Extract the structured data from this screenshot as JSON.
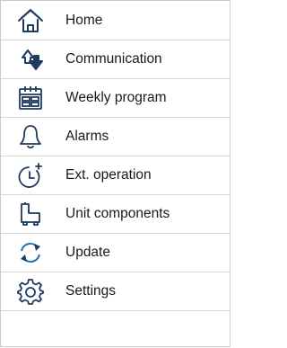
{
  "menu": {
    "items": [
      {
        "label": "Home",
        "icon": "home-icon"
      },
      {
        "label": "Communication",
        "icon": "communication-icon"
      },
      {
        "label": "Weekly program",
        "icon": "calendar-icon"
      },
      {
        "label": "Alarms",
        "icon": "bell-icon"
      },
      {
        "label": "Ext. operation",
        "icon": "clock-plus-icon"
      },
      {
        "label": "Unit components",
        "icon": "unit-components-icon"
      },
      {
        "label": "Update",
        "icon": "update-icon"
      },
      {
        "label": "Settings",
        "icon": "gear-icon"
      }
    ]
  },
  "colors": {
    "icon_stroke": "#1f3a5f",
    "icon_accent": "#1f6fb5",
    "divider": "#d9d9d9",
    "text": "#1a1a1a"
  }
}
